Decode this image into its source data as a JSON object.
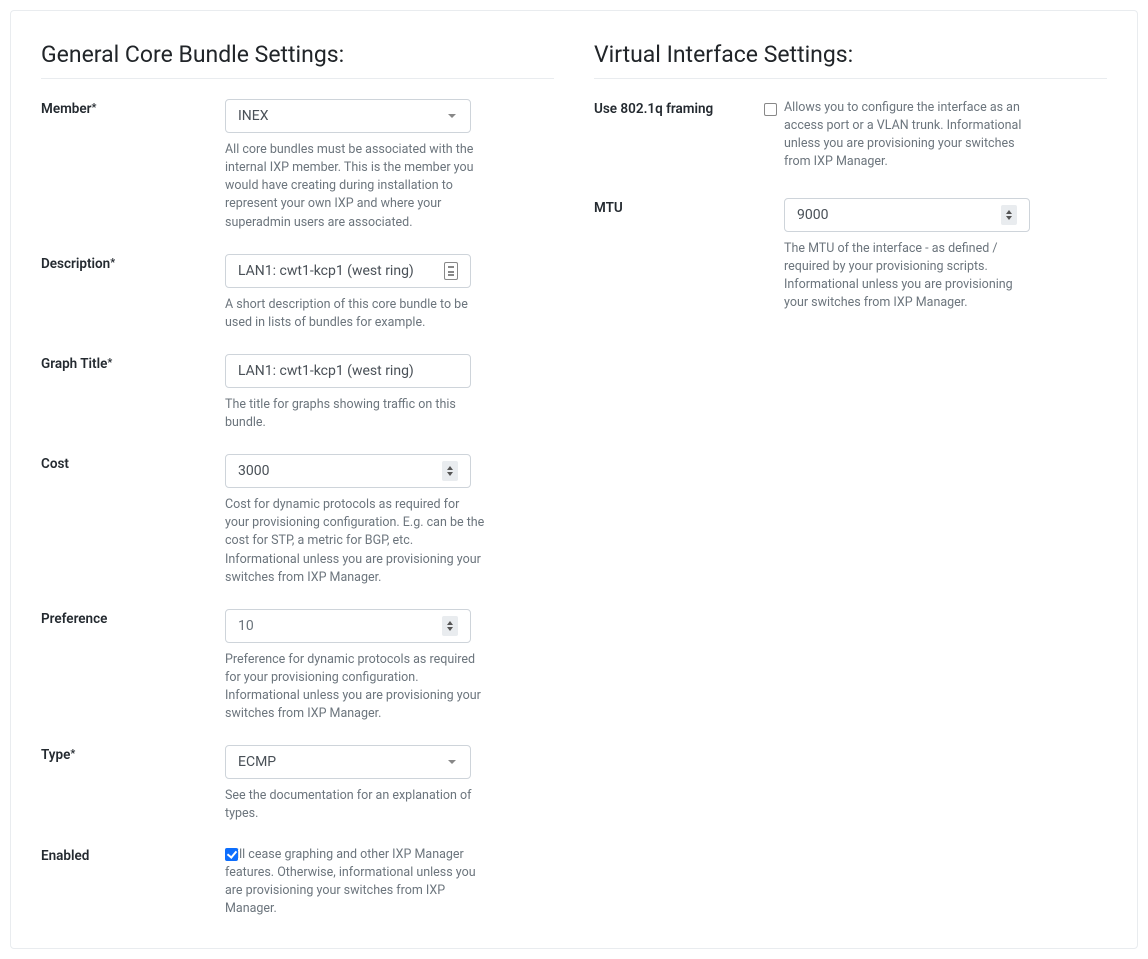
{
  "general": {
    "title": "General Core Bundle Settings:",
    "member": {
      "label": "Member",
      "value": "INEX",
      "help": "All core bundles must be associated with the internal IXP member. This is the member you would have creating during installation to represent your own IXP and where your superadmin users are associated."
    },
    "description": {
      "label": "Description",
      "value": "LAN1: cwt1-kcp1 (west ring)",
      "help": "A short description of this core bundle to be used in lists of bundles for example."
    },
    "graph_title": {
      "label": "Graph Title",
      "value": "LAN1: cwt1-kcp1 (west ring)",
      "help": "The title for graphs showing traffic on this bundle."
    },
    "cost": {
      "label": "Cost",
      "value": "3000",
      "help": "Cost for dynamic protocols as required for your provisioning configuration. E.g. can be the cost for STP, a metric for BGP, etc. Informational unless you are provisioning your switches from IXP Manager."
    },
    "preference": {
      "label": "Preference",
      "placeholder": "10",
      "help": "Preference for dynamic protocols as required for your provisioning configuration. Informational unless you are provisioning your switches from IXP Manager."
    },
    "type": {
      "label": "Type",
      "value": "ECMP",
      "help": "See the documentation for an explanation of types."
    },
    "enabled": {
      "label": "Enabled",
      "checked": true,
      "help": "Will cease graphing and other IXP Manager features. Otherwise, informational unless you are provisioning your switches from IXP Manager."
    }
  },
  "virtual": {
    "title": "Virtual Interface Settings:",
    "use8021q": {
      "label": "Use 802.1q framing",
      "checked": false,
      "help": "Allows you to configure the interface as an access port or a VLAN trunk. Informational unless you are provisioning your switches from IXP Manager."
    },
    "mtu": {
      "label": "MTU",
      "value": "9000",
      "help": "The MTU of the interface - as defined / required by your provisioning scripts. Informational unless you are provisioning your switches from IXP Manager."
    }
  }
}
